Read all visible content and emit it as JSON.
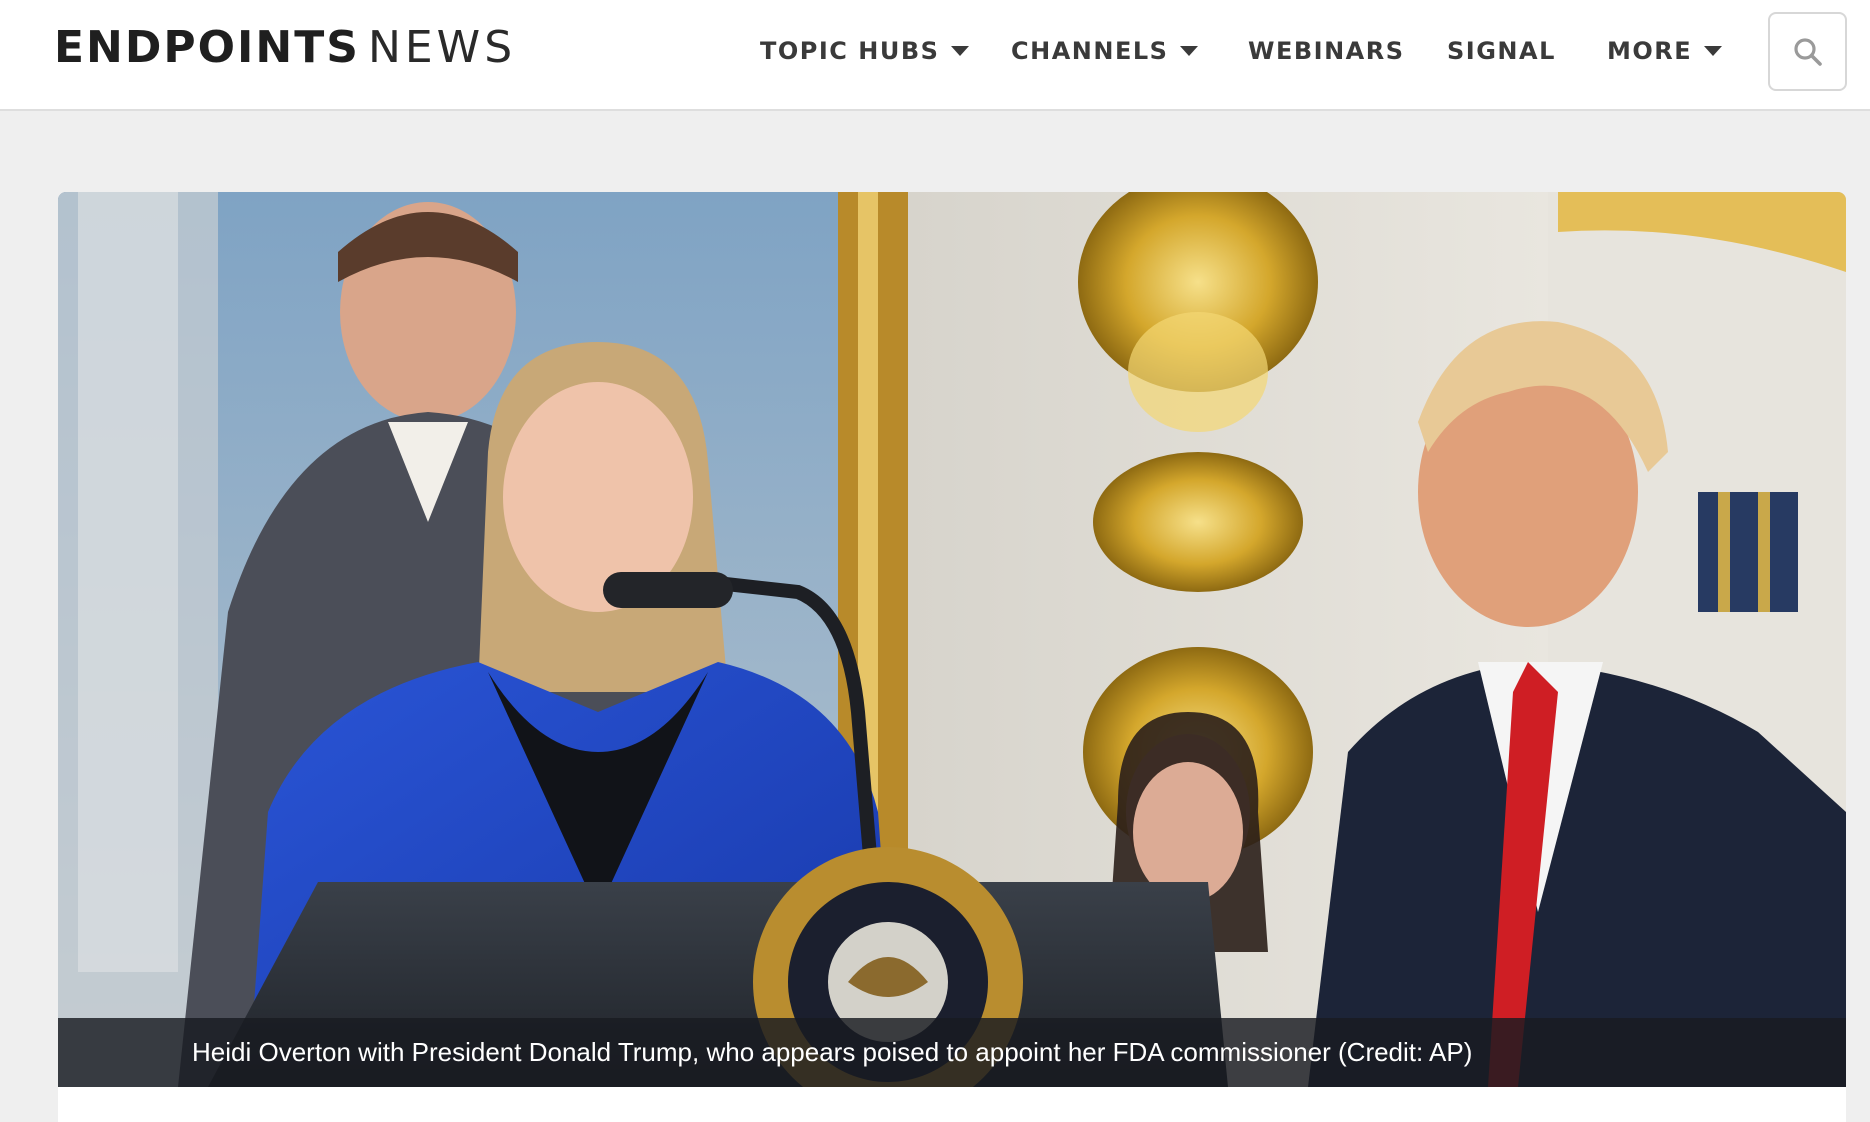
{
  "header": {
    "logo_strong": "ENDPOINTS",
    "logo_light": "NEWS",
    "nav": [
      {
        "label": "TOPIC HUBS",
        "has_dropdown": true
      },
      {
        "label": "CHANNELS",
        "has_dropdown": true
      },
      {
        "label": "WEBINARS",
        "has_dropdown": false
      },
      {
        "label": "SIGNAL",
        "has_dropdown": false
      },
      {
        "label": "MORE",
        "has_dropdown": true
      }
    ],
    "search_icon": "search-icon"
  },
  "hero": {
    "image_subject": "photo",
    "caption": "Heidi Overton with President Donald Trump, who appears poised to appoint her FDA commissioner (Credit: AP)"
  },
  "colors": {
    "page_bg": "#efefef",
    "header_bg": "#ffffff",
    "nav_text": "#3a3a3a",
    "caption_bg": "#191b21"
  }
}
